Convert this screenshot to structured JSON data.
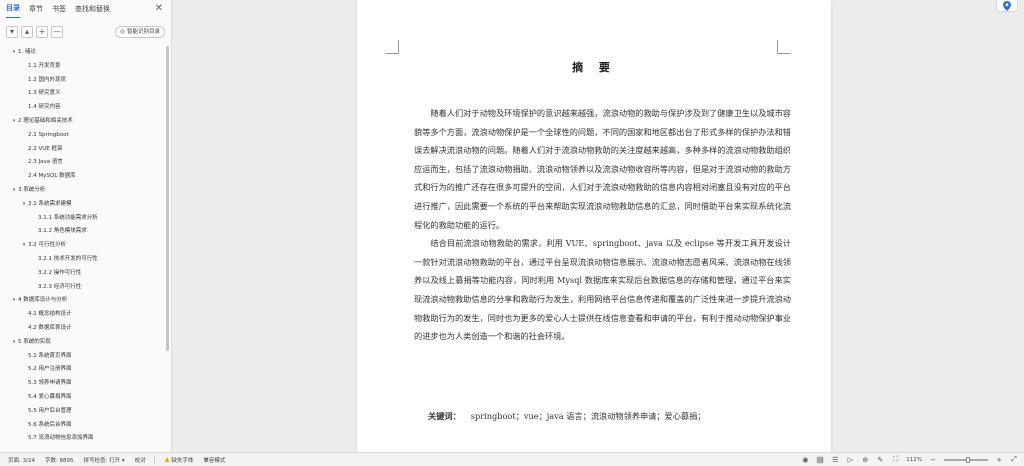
{
  "nav": {
    "tabs": [
      {
        "label": "目录",
        "active": true
      },
      {
        "label": "章节",
        "active": false
      },
      {
        "label": "书签",
        "active": false
      },
      {
        "label": "查找和替换",
        "active": false
      }
    ],
    "close_icon": "close-icon",
    "tools": [
      "▾",
      "▴",
      "+",
      "—"
    ],
    "smart_button_label": "智能识别目录",
    "toc": [
      {
        "level": 1,
        "label": "1. 绪论",
        "caret": "▾"
      },
      {
        "level": 2,
        "label": "1.1 开发背景"
      },
      {
        "level": 2,
        "label": "1.2 国内外现状"
      },
      {
        "level": 2,
        "label": "1.3 研究意义"
      },
      {
        "level": 2,
        "label": "1.4 研究内容"
      },
      {
        "level": 1,
        "label": "2 理论基础和相关技术",
        "caret": "▾"
      },
      {
        "level": 2,
        "label": "2.1 Springboot"
      },
      {
        "level": 2,
        "label": "2.2 VUE 框架"
      },
      {
        "level": 2,
        "label": "2.3 Java 语言"
      },
      {
        "level": 2,
        "label": "2.4 MySQL 数据库"
      },
      {
        "level": 1,
        "label": "3 系统分析",
        "caret": "▾"
      },
      {
        "level": "2c",
        "label": "3.1 系统需求建模",
        "caret": "▾"
      },
      {
        "level": 3,
        "label": "3.1.1 系统功能需求分析"
      },
      {
        "level": 3,
        "label": "3.1.2 角色模块需求"
      },
      {
        "level": "2c",
        "label": "3.2 可行性分析",
        "caret": "▾"
      },
      {
        "level": 3,
        "label": "3.2.1 技术开发的可行性"
      },
      {
        "level": 3,
        "label": "3.2.2 操作可行性"
      },
      {
        "level": 3,
        "label": "3.2.3 经济可行性"
      },
      {
        "level": 1,
        "label": "4 数据库设计与分析",
        "caret": "▾"
      },
      {
        "level": 2,
        "label": "4.1 概念结构设计"
      },
      {
        "level": 2,
        "label": "4.2 数据库表设计"
      },
      {
        "level": 1,
        "label": "5 系统的实现",
        "caret": "▾"
      },
      {
        "level": 2,
        "label": "5.1 系统首页界面"
      },
      {
        "level": 2,
        "label": "5.2 用户注册界面"
      },
      {
        "level": 2,
        "label": "5.3 领养申请界面"
      },
      {
        "level": 2,
        "label": "5.4 爱心募捐界面"
      },
      {
        "level": 2,
        "label": "5.5 用户后台管理"
      },
      {
        "level": 2,
        "label": "5.6 系统后台界面"
      },
      {
        "level": 2,
        "label": "5.7 流浪动物信息添加界面"
      }
    ]
  },
  "document": {
    "title": "摘 要",
    "paragraphs": [
      "随着人们对于动物及环境保护的意识越来越强，流浪动物的救助与保护涉及到了健康卫生以及城市容貌等多个方面，流浪动物保护是一个全球性的问题，不同的国家和地区都出台了形式多样的保护办法和错误去解决流浪动物的问题。随着人们对于流浪动物救助的关注度越来越高，多种多样的流浪动物救助组织应运而生，包括了流浪动物捐助、流浪动物领养以及流浪动物收容所等内容，但是对于流浪动物的救助方式和行为的推广还存在很多可提升的空间，人们对于流浪动物救助的信息内容相对闭塞且没有对应的平台进行推广，因此需要一个系统的平台来帮助实现流浪动物救助信息的汇总，同时借助平台来实现系统化流程化的救助功能的运行。",
      "结合目前流浪动物救助的需求，利用 VUE、springboot、java 以及 eclipse 等开发工具开发设计一款针对流浪动物救助的平台，通过平台呈现流浪动物信息展示、流浪动物志愿者风采、流浪动物在线领养以及线上募捐等功能内容，同时利用 Mysql 数据库来实现后台数据信息的存储和管理，通过平台来实现流浪动物救助信息的分享和救助行为发生，利用网络平台信息传递和覆盖的广泛性来进一步提升流浪动物救助行为的发生，同时也为更多的爱心人士提供在线信息查看和申请的平台，有利于推动动物保护事业的进步也为人类创造一个和谐的社会环境。"
    ],
    "keywords_label": "关键词：",
    "keywords_text": "springboot；vue；java 语言；流浪动物领养申请；爱心募捐；"
  },
  "status_bar": {
    "page": "页面: 3/24",
    "word_count": "字数: 8895",
    "spell_check": "拼写检查: 打开 ▾",
    "proofread": "校对",
    "missing_font": "缺失字体",
    "compat_mode": "兼容模式",
    "zoom": "112%",
    "zoom_fraction": 0.55,
    "icons": [
      "eye-icon",
      "page-view-icon",
      "outline-icon",
      "play-icon",
      "web-icon",
      "pen-icon",
      "fit-icon"
    ]
  },
  "colors": {
    "accent": "#2f6ce5",
    "warning": "#e0a100"
  }
}
